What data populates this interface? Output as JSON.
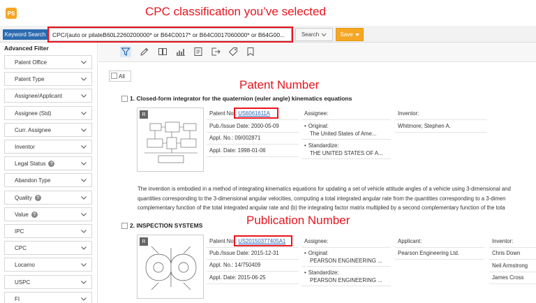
{
  "app": {
    "logo_text": "PS"
  },
  "annotations": {
    "cpc": "CPC classification you’ve selected",
    "patent_number": "Patent Number",
    "publication_number": "Publication Number"
  },
  "search": {
    "mode_label": "Keyword Search",
    "query": "CPC/(auto or pilateB60L2260200000* or B64C0017* or B64C0017060000* or B64G00...",
    "search_label": "Search",
    "save_label": "Save"
  },
  "sidebar": {
    "title": "Advanced Filter",
    "filters": [
      {
        "label": "Patent Office",
        "help": ""
      },
      {
        "label": "Patent Type",
        "help": ""
      },
      {
        "label": "Assignee/Applicant",
        "help": ""
      },
      {
        "label": "Assignee (Std)",
        "help": ""
      },
      {
        "label": "Curr. Assignee",
        "help": ""
      },
      {
        "label": "Inventor",
        "help": ""
      },
      {
        "label": "Legal Status",
        "help": "?"
      },
      {
        "label": "Abandon Type",
        "help": ""
      },
      {
        "label": "Quality",
        "help": "?"
      },
      {
        "label": "Value",
        "help": "?"
      },
      {
        "label": "IPC",
        "help": ""
      },
      {
        "label": "CPC",
        "help": ""
      },
      {
        "label": "Locarno",
        "help": ""
      },
      {
        "label": "USPC",
        "help": ""
      },
      {
        "label": "FI",
        "help": ""
      }
    ]
  },
  "toolbar": {
    "icons": [
      "filter-icon",
      "pencil-icon",
      "book-icon",
      "chart-icon",
      "export-icon",
      "share-icon",
      "tag-icon",
      "bookmark-icon"
    ]
  },
  "results": {
    "all_label": "All",
    "items": [
      {
        "index": "1.",
        "title": "Closed-form integrator for the quaternion (euler angle) kinematics equations",
        "thumb_badge": "R",
        "patent_no_label": "Patent No.:",
        "patent_no": "US6061611A",
        "pub_date_label": "Pub./Issue Date:",
        "pub_date": "2000-05-09",
        "appl_no_label": "Appl. No.:",
        "appl_no": "09/002871",
        "appl_date_label": "Appl. Date:",
        "appl_date": "1998-01-06",
        "assignee_label": "Assignee:",
        "original_label": "Original:",
        "original": "The United States of Ame...",
        "standardize_label": "Standardize:",
        "standardize": "THE UNITED STATES OF A...",
        "inventor_label": "Inventor:",
        "inventors": [
          "Whitmore; Stephen A."
        ],
        "abstract": [
          "The invention is embodied in a method of integrating kinematics equations for updating a set of vehicle attitude angles of a vehicle using 3-dimensional and",
          "quantities corresponding to the 3-dimensional angular velocities, computing a total integrated angular rate from the quantities corresponding to a 3-dimen",
          "complementary function of the total integrated angular rate and (b) the integrating factor matrix multiplied by a second complementary function of the tota"
        ]
      },
      {
        "index": "2.",
        "title": "INSPECTION SYSTEMS",
        "thumb_badge": "R",
        "patent_no_label": "Patent No.:",
        "patent_no": "US20150377405A1",
        "pub_date_label": "Pub./Issue Date:",
        "pub_date": "2015-12-31",
        "appl_no_label": "Appl. No.:",
        "appl_no": "14/750409",
        "appl_date_label": "Appl. Date:",
        "appl_date": "2015-06-25",
        "assignee_label": "Assignee:",
        "original_label": "Original:",
        "original": "PEARSON ENGINEERING ...",
        "standardize_label": "Standardize:",
        "standardize": "PEARSON ENGINEERING ...",
        "applicant_label": "Applicant:",
        "applicant": "Pearson Engineering Ltd.",
        "inventor_label": "Inventor:",
        "inventors": [
          "Chris Down",
          "Neil Armstrong",
          "James Cross"
        ]
      }
    ]
  },
  "colors": {
    "accent_blue": "#2c6bb0",
    "save_orange": "#f5a623",
    "annotation_red": "#e8141e",
    "link_blue": "#2a63b8"
  }
}
